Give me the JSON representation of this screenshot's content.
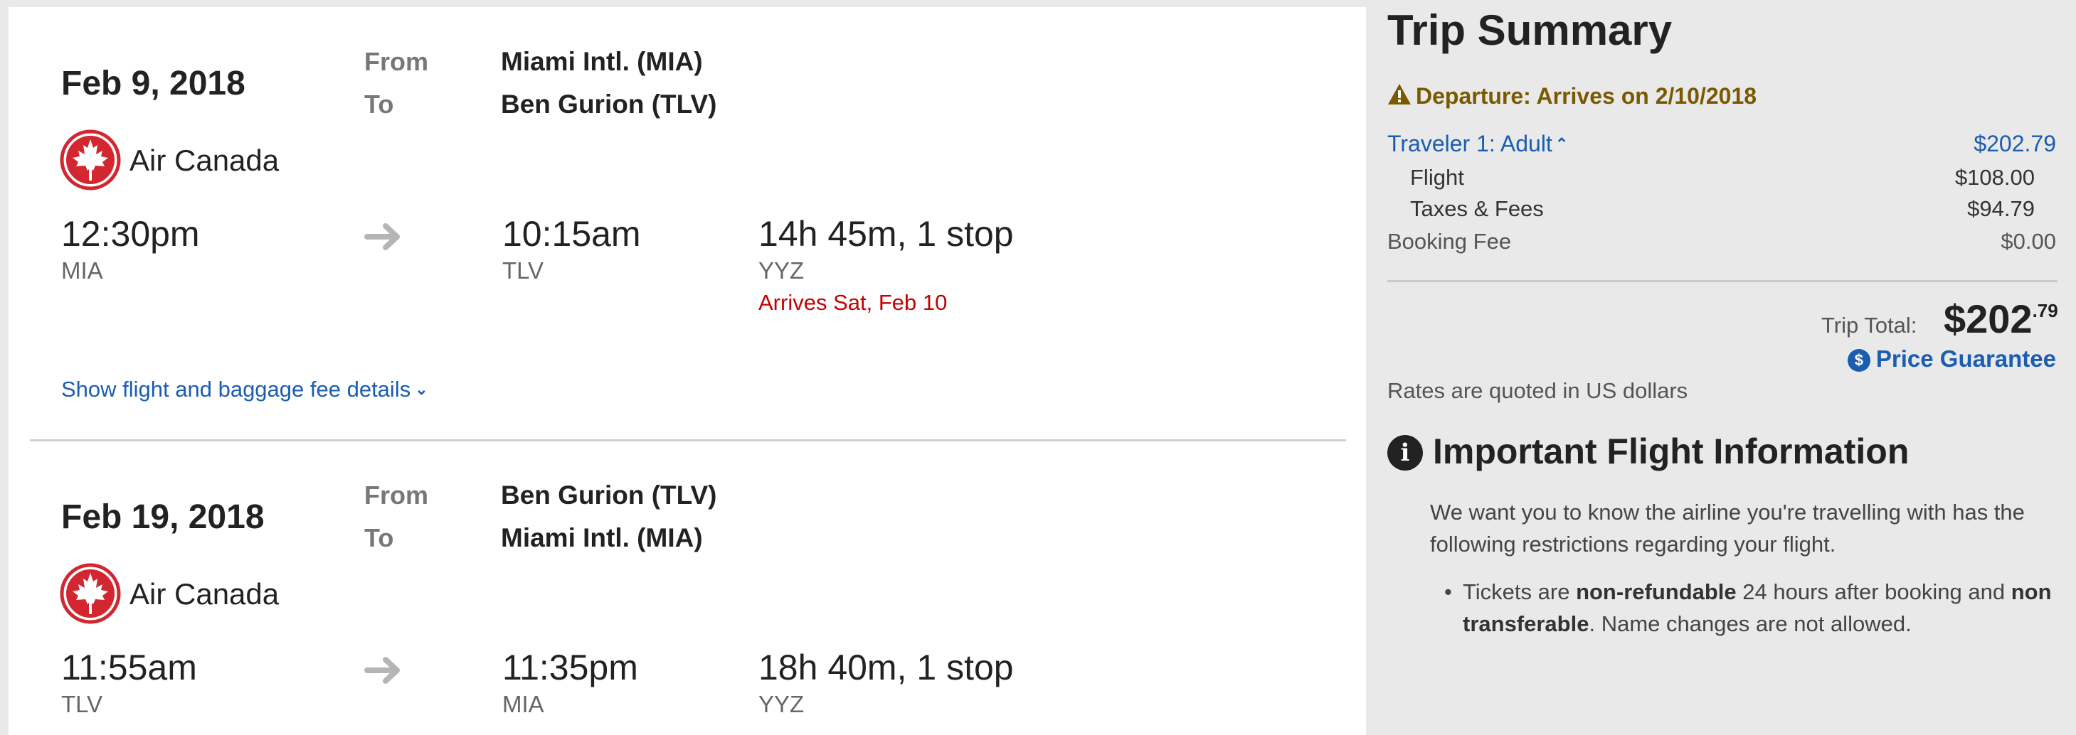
{
  "flights": [
    {
      "date": "Feb 9, 2018",
      "from_label": "From",
      "to_label": "To",
      "from_airport": "Miami Intl. (MIA)",
      "to_airport": "Ben Gurion (TLV)",
      "airline": "Air Canada",
      "depart_time": "12:30pm",
      "depart_code": "MIA",
      "arrive_time": "10:15am",
      "arrive_code": "TLV",
      "duration": "14h 45m, 1 stop",
      "stop_code": "YYZ",
      "arrives_note": "Arrives Sat, Feb 10",
      "details_link": "Show flight and baggage fee details"
    },
    {
      "date": "Feb 19, 2018",
      "from_label": "From",
      "to_label": "To",
      "from_airport": "Ben Gurion (TLV)",
      "to_airport": "Miami Intl. (MIA)",
      "airline": "Air Canada",
      "depart_time": "11:55am",
      "depart_code": "TLV",
      "arrive_time": "11:35pm",
      "arrive_code": "MIA",
      "duration": "18h 40m, 1 stop",
      "stop_code": "YYZ"
    }
  ],
  "summary": {
    "title": "Trip Summary",
    "warning": "Departure: Arrives on 2/10/2018",
    "traveler_label": "Traveler 1: Adult",
    "traveler_total": "$202.79",
    "rows": [
      {
        "label": "Flight",
        "value": "$108.00"
      },
      {
        "label": "Taxes & Fees",
        "value": "$94.79"
      },
      {
        "label": "Booking Fee",
        "value": "$0.00"
      }
    ],
    "trip_total_label": "Trip Total:",
    "trip_total_dollars": "$202",
    "trip_total_cents": ".79",
    "price_guarantee": "Price Guarantee",
    "rates_note": "Rates are quoted in US dollars"
  },
  "important_info": {
    "title": "Important Flight Information",
    "intro": "We want you to know the airline you're travelling with has the following restrictions regarding your flight.",
    "bullet_parts": {
      "p1": "Tickets are ",
      "b1": "non-refundable",
      "p2": " 24 hours after booking and ",
      "b2": "non transferable",
      "p3": ". Name changes are not allowed."
    }
  },
  "colors": {
    "link_blue": "#1a5db1",
    "alert_red": "#c40000",
    "warning_brown": "#7a5a00",
    "air_canada_red": "#d22630"
  },
  "icons": {
    "airline_logo": "air-canada-maple-leaf-icon",
    "arrow": "right-arrow-icon",
    "warning": "warning-triangle-icon",
    "price_guarantee": "dollar-circle-icon",
    "info": "info-circle-icon",
    "expand": "chevron-double-down-icon",
    "collapse": "chevron-double-up-icon"
  }
}
